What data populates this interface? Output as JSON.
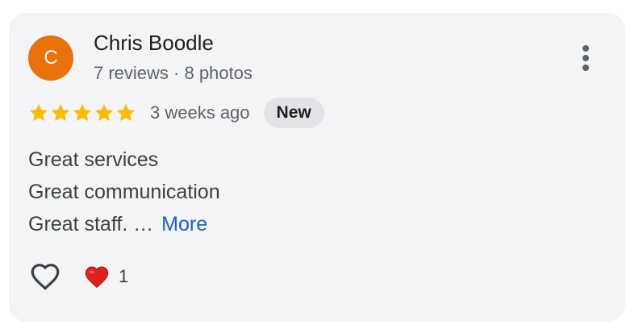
{
  "review": {
    "author": {
      "initial": "C",
      "name": "Chris Boodle",
      "meta": "7 reviews · 8 photos",
      "avatar_color": "#e8710a"
    },
    "rating": 5,
    "max_rating": 5,
    "time": "3 weeks ago",
    "badge": "New",
    "text_lines": [
      "Great services",
      "Great communication",
      "Great staff. …"
    ],
    "more_label": "More",
    "reaction_count": "1",
    "colors": {
      "star": "#fbbc04",
      "link": "#1a5fc7",
      "card_bg": "#f3f4f6",
      "badge_bg": "#e1e3e6"
    },
    "icons": {
      "menu": "more-vert-icon",
      "like": "heart-outline-icon",
      "reaction": "red-heart-icon"
    }
  }
}
